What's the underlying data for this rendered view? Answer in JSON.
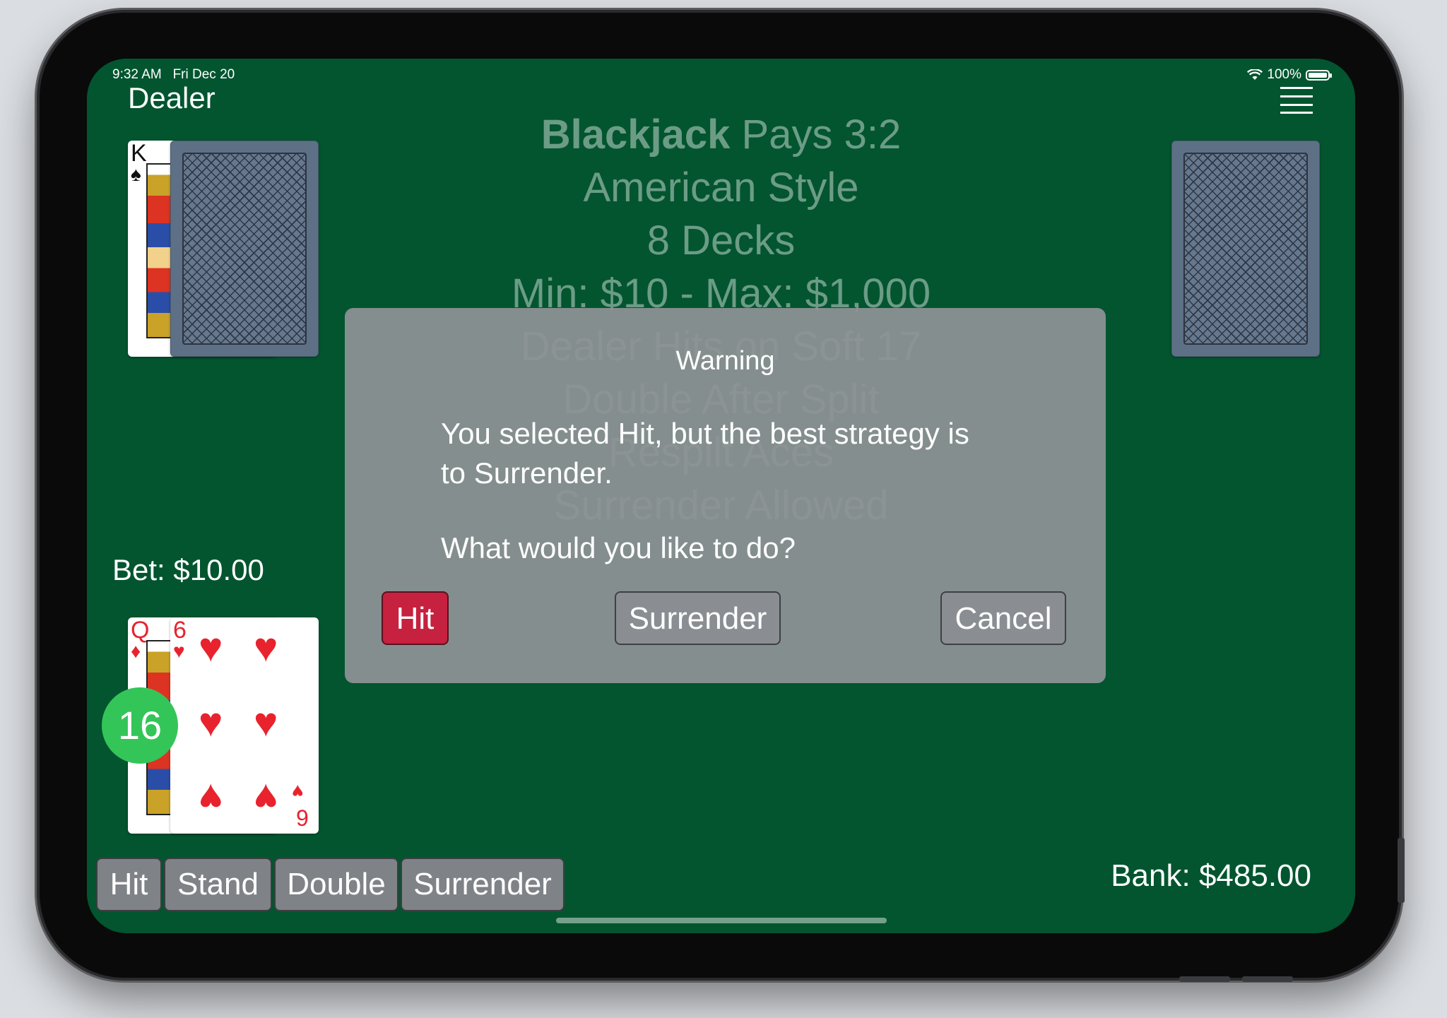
{
  "status_bar": {
    "time": "9:32 AM",
    "date": "Fri Dec 20",
    "battery": "100%"
  },
  "dealer": {
    "label": "Dealer",
    "cards": [
      {
        "rank": "K",
        "suit": "♠",
        "face_up": true
      },
      {
        "face_up": false
      }
    ]
  },
  "menu": {
    "icon": "hamburger-menu-icon"
  },
  "table_rules": {
    "line1_bold": "Blackjack",
    "line1_rest": " Pays 3:2",
    "lines": [
      "American Style",
      "8 Decks",
      "Min: $10 - Max: $1,000",
      "Dealer Hits on Soft 17",
      "Double After Split",
      "Respilt Aces",
      "Surrender Allowed"
    ]
  },
  "shoe": {
    "face_up": false
  },
  "player": {
    "bet": "Bet: $10.00",
    "hand_total": "16",
    "cards": [
      {
        "rank": "Q",
        "suit": "♦",
        "color": "#e8232e"
      },
      {
        "rank": "6",
        "suit": "♥",
        "bottom_rank": "9",
        "color": "#e8232e"
      }
    ],
    "bank": "Bank: $485.00"
  },
  "actions": [
    "Hit",
    "Stand",
    "Double",
    "Surrender"
  ],
  "alert": {
    "title": "Warning",
    "message": "You selected Hit, but the best strategy is\nto Surrender.",
    "question": "What would you like to do?",
    "buttons": {
      "hit": "Hit",
      "surrender": "Surrender",
      "cancel": "Cancel"
    }
  },
  "colors": {
    "table_green": "#02552f",
    "hand_total_badge": "#34c559",
    "alert_primary": "#c6213f",
    "button_gray": "#7f8286",
    "card_back": "#5e7086"
  }
}
